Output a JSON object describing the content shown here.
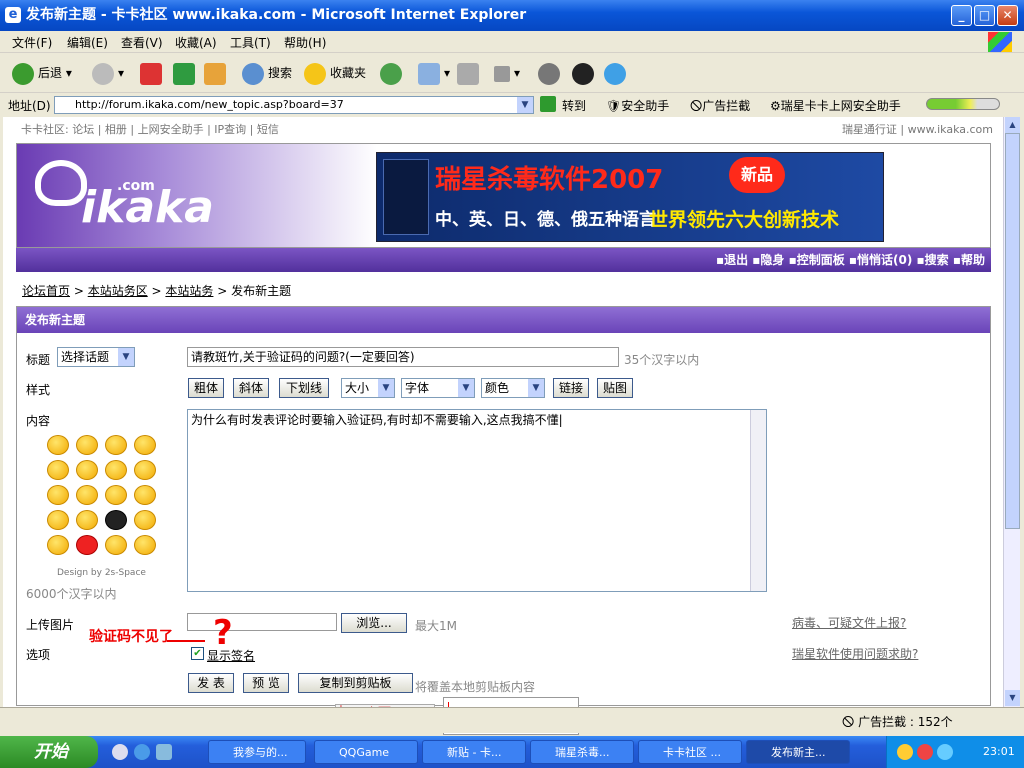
{
  "window": {
    "title": "发布新主题 - 卡卡社区 www.ikaka.com - Microsoft Internet Explorer"
  },
  "menu": [
    "文件(F)",
    "编辑(E)",
    "查看(V)",
    "收藏(A)",
    "工具(T)",
    "帮助(H)"
  ],
  "toolbar": {
    "back": "后退",
    "search": "搜索",
    "favorites": "收藏夹"
  },
  "address": {
    "label": "地址(D)",
    "url": "http://forum.ikaka.com/new_topic.asp?board=37",
    "go": "转到",
    "links": [
      "安全助手",
      "广告拦截",
      "瑞星卡卡上网安全助手"
    ]
  },
  "toplinks": {
    "left": "卡卡社区: 论坛 | 相册 | 上网安全助手 | IP查询 | 短信",
    "right": "瑞星通行证 | www.ikaka.com"
  },
  "logo": {
    "brand": "ikaka",
    "com": ".com"
  },
  "banner": {
    "line1": "瑞星杀毒软件2007",
    "badge": "新品",
    "line2": "中、英、日、德、俄五种语言",
    "line3": "世界领先六大创新技术"
  },
  "nav": "▪退出 ▪隐身 ▪控制面板 ▪悄悄话(0) ▪搜索 ▪帮助",
  "breadcrumb": [
    "论坛首页",
    "本站站务区",
    "本站站务",
    "发布新主题"
  ],
  "form": {
    "panel_title": "发布新主题",
    "title_label": "标题",
    "topic_select": "选择话题",
    "title_value": "请教斑竹,关于验证码的问题?(一定要回答)",
    "title_hint": "35个汉字以内",
    "style_label": "样式",
    "style_buttons": [
      "粗体",
      "斜体",
      "下划线"
    ],
    "style_selects": [
      "大小",
      "字体",
      "颜色"
    ],
    "style_buttons2": [
      "链接",
      "贴图"
    ],
    "content_label": "内容",
    "content_value": "为什么有时发表评论时要输入验证码,有时却不需要输入,这点我搞不懂|",
    "emoji_credit": "Design by 2s-Space",
    "content_hint": "6000个汉字以内",
    "upload_label": "上传图片",
    "browse": "浏览...",
    "upload_hint": "最大1M",
    "options_label": "选项",
    "signature": "显示签名",
    "submit": "发 表",
    "preview": "预 览",
    "copy": "复制到剪贴板",
    "copy_hint": "将覆盖本地剪贴板内容",
    "annotation": "验证码不见了",
    "report_link": "病毒、可疑文件上报?",
    "help_link": "瑞星软件使用问题求助?"
  },
  "status": {
    "adblock": "广告拦截 : 152个"
  },
  "taskbar": {
    "start": "开始",
    "tasks": [
      "我参与的...",
      "QQGame",
      "新贴 - 卡...",
      "瑞星杀毒...",
      "卡卡社区 ...",
      "发布新主..."
    ],
    "clock": "23:01"
  }
}
